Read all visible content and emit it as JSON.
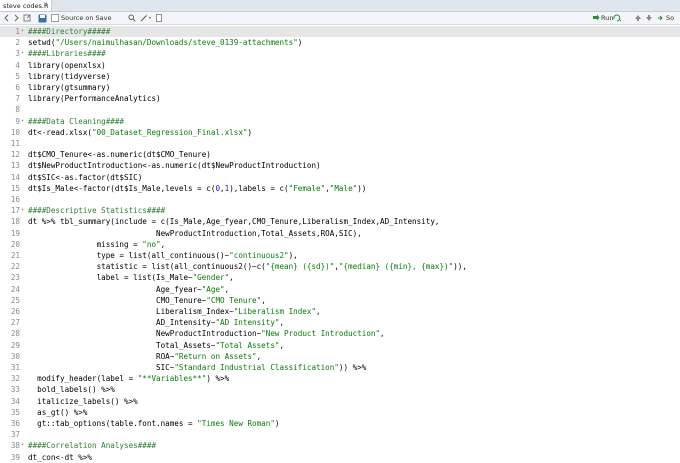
{
  "tab": {
    "filename": "steve codes.R"
  },
  "toolbar": {
    "source_on_save": "Source on Save",
    "run_label": "Run",
    "source_label": "So"
  },
  "editor": {
    "lines": [
      {
        "n": "1",
        "fold": true,
        "segs": [
          [
            "com",
            "####Directory#####"
          ]
        ]
      },
      {
        "n": "2",
        "segs": [
          [
            "txt",
            "setwd("
          ],
          [
            "str",
            "\"/Users/naimulhasan/Downloads/steve_0139-attachments\""
          ],
          [
            "txt",
            ")"
          ]
        ]
      },
      {
        "n": "3",
        "fold": true,
        "segs": [
          [
            "com",
            "####Libraries####"
          ]
        ]
      },
      {
        "n": "4",
        "segs": [
          [
            "txt",
            "library(openxlsx)"
          ]
        ]
      },
      {
        "n": "5",
        "segs": [
          [
            "txt",
            "library(tidyverse)"
          ]
        ]
      },
      {
        "n": "6",
        "segs": [
          [
            "txt",
            "library(gtsummary)"
          ]
        ]
      },
      {
        "n": "7",
        "segs": [
          [
            "txt",
            "library(PerformanceAnalytics)"
          ]
        ]
      },
      {
        "n": "8",
        "segs": [
          [
            "txt",
            ""
          ]
        ]
      },
      {
        "n": "9",
        "fold": true,
        "segs": [
          [
            "com",
            "####Data Cleaning####"
          ]
        ]
      },
      {
        "n": "10",
        "segs": [
          [
            "txt",
            "dt<-read.xlsx("
          ],
          [
            "str",
            "\"00_Dataset_Regression_Final.xlsx\""
          ],
          [
            "txt",
            ")"
          ]
        ]
      },
      {
        "n": "11",
        "segs": [
          [
            "txt",
            ""
          ]
        ]
      },
      {
        "n": "12",
        "segs": [
          [
            "txt",
            "dt$CMO_Tenure<-as.numeric(dt$CMO_Tenure)"
          ]
        ]
      },
      {
        "n": "13",
        "segs": [
          [
            "txt",
            "dt$NewProductIntroduction<-as.numeric(dt$NewProductIntroduction)"
          ]
        ]
      },
      {
        "n": "14",
        "segs": [
          [
            "txt",
            "dt$SIC<-as.factor(dt$SIC)"
          ]
        ]
      },
      {
        "n": "15",
        "segs": [
          [
            "txt",
            "dt$Is_Male<-factor(dt$Is_Male,levels = c("
          ],
          [
            "num",
            "0"
          ],
          [
            "txt",
            ","
          ],
          [
            "num",
            "1"
          ],
          [
            "txt",
            "),labels = c("
          ],
          [
            "str",
            "\"Female\""
          ],
          [
            "txt",
            ","
          ],
          [
            "str",
            "\"Male\""
          ],
          [
            "txt",
            "))"
          ]
        ]
      },
      {
        "n": "16",
        "segs": [
          [
            "txt",
            ""
          ]
        ]
      },
      {
        "n": "17",
        "fold": true,
        "segs": [
          [
            "com",
            "####Descriptive Statistics####"
          ]
        ]
      },
      {
        "n": "18",
        "segs": [
          [
            "txt",
            "dt %>% tbl_summary(include = c(Is_Male,Age_fyear,CMO_Tenure,Liberalism_Index,AD_Intensity,"
          ]
        ]
      },
      {
        "n": "19",
        "segs": [
          [
            "txt",
            "                            NewProductIntroduction,Total_Assets,ROA,SIC),"
          ]
        ]
      },
      {
        "n": "20",
        "segs": [
          [
            "txt",
            "               missing = "
          ],
          [
            "str",
            "\"no\""
          ],
          [
            "txt",
            ","
          ]
        ]
      },
      {
        "n": "21",
        "segs": [
          [
            "txt",
            "               type = list(all_continuous()~"
          ],
          [
            "str",
            "\"continuous2\""
          ],
          [
            "txt",
            "),"
          ]
        ]
      },
      {
        "n": "22",
        "segs": [
          [
            "txt",
            "               statistic = list(all_continuous2()~c("
          ],
          [
            "str",
            "\"{mean} ({sd})\""
          ],
          [
            "txt",
            ","
          ],
          [
            "str",
            "\"{median} ({min}, {max})\""
          ],
          [
            "txt",
            ")),"
          ]
        ]
      },
      {
        "n": "23",
        "segs": [
          [
            "txt",
            "               label = list(Is_Male~"
          ],
          [
            "str",
            "\"Gender\""
          ],
          [
            "txt",
            ","
          ]
        ]
      },
      {
        "n": "24",
        "segs": [
          [
            "txt",
            "                            Age_fyear~"
          ],
          [
            "str",
            "\"Age\""
          ],
          [
            "txt",
            ","
          ]
        ]
      },
      {
        "n": "25",
        "segs": [
          [
            "txt",
            "                            CMO_Tenure~"
          ],
          [
            "str",
            "\"CMO Tenure\""
          ],
          [
            "txt",
            ","
          ]
        ]
      },
      {
        "n": "26",
        "segs": [
          [
            "txt",
            "                            Liberalism_Index~"
          ],
          [
            "str",
            "\"Liberalism Index\""
          ],
          [
            "txt",
            ","
          ]
        ]
      },
      {
        "n": "27",
        "segs": [
          [
            "txt",
            "                            AD_Intensity~"
          ],
          [
            "str",
            "\"AD Intensity\""
          ],
          [
            "txt",
            ","
          ]
        ]
      },
      {
        "n": "28",
        "segs": [
          [
            "txt",
            "                            NewProductIntroduction~"
          ],
          [
            "str",
            "\"New Product Introduction\""
          ],
          [
            "txt",
            ","
          ]
        ]
      },
      {
        "n": "29",
        "segs": [
          [
            "txt",
            "                            Total_Assets~"
          ],
          [
            "str",
            "\"Total Assets\""
          ],
          [
            "txt",
            ","
          ]
        ]
      },
      {
        "n": "30",
        "segs": [
          [
            "txt",
            "                            ROA~"
          ],
          [
            "str",
            "\"Return on Assets\""
          ],
          [
            "txt",
            ","
          ]
        ]
      },
      {
        "n": "31",
        "segs": [
          [
            "txt",
            "                            SIC~"
          ],
          [
            "str",
            "\"Standard Industrial Classification\""
          ],
          [
            "txt",
            ")) %>%"
          ]
        ]
      },
      {
        "n": "32",
        "segs": [
          [
            "txt",
            "  modify_header(label = "
          ],
          [
            "str",
            "\"**Variables**\""
          ],
          [
            "txt",
            ") %>%"
          ]
        ]
      },
      {
        "n": "33",
        "segs": [
          [
            "txt",
            "  bold_labels() %>%"
          ]
        ]
      },
      {
        "n": "34",
        "segs": [
          [
            "txt",
            "  italicize_labels() %>%"
          ]
        ]
      },
      {
        "n": "35",
        "segs": [
          [
            "txt",
            "  as_gt() %>%"
          ]
        ]
      },
      {
        "n": "36",
        "segs": [
          [
            "txt",
            "  gt::tab_options(table.font.names = "
          ],
          [
            "str",
            "\"Times New Roman\""
          ],
          [
            "txt",
            ")"
          ]
        ]
      },
      {
        "n": "37",
        "segs": [
          [
            "txt",
            ""
          ]
        ]
      },
      {
        "n": "38",
        "fold": true,
        "segs": [
          [
            "com",
            "####Correlation Analyses####"
          ]
        ]
      },
      {
        "n": "39",
        "segs": [
          [
            "txt",
            "dt_con<-dt %>%"
          ]
        ]
      }
    ]
  }
}
